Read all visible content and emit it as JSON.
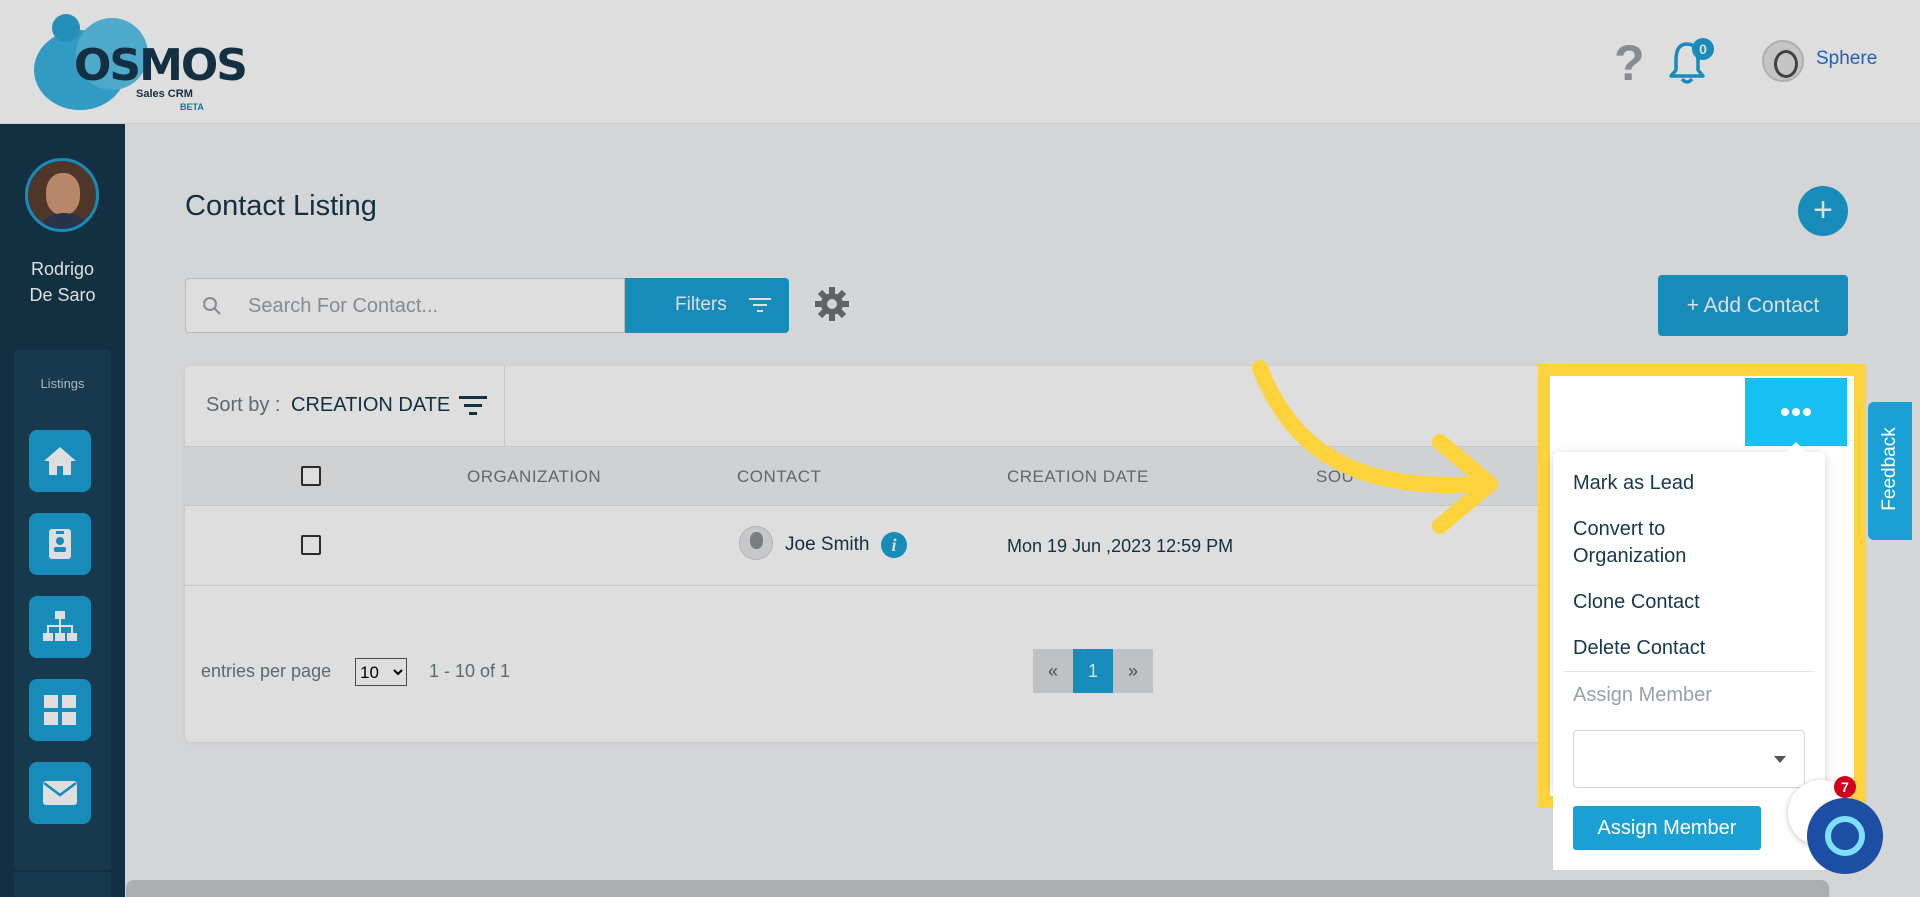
{
  "header": {
    "logo_text": "OSMOS",
    "logo_sub": "Sales CRM",
    "logo_beta": "BETA",
    "help_icon": "question-mark-icon",
    "notification_count": "0",
    "user_name": "Sphere"
  },
  "sidebar": {
    "user_name_line1": "Rodrigo",
    "user_name_line2": "De Saro",
    "section_label": "Listings",
    "items": [
      {
        "icon": "home-icon"
      },
      {
        "icon": "contact-card-icon"
      },
      {
        "icon": "org-chart-icon"
      },
      {
        "icon": "grid-icon"
      },
      {
        "icon": "mail-icon"
      }
    ]
  },
  "page": {
    "title": "Contact Listing",
    "search_placeholder": "Search For Contact...",
    "filters_label": "Filters",
    "add_contact_label": "+ Add Contact",
    "sort_label": "Sort by :",
    "sort_value": "CREATION DATE"
  },
  "table": {
    "columns": [
      "ORGANIZATION",
      "CONTACT",
      "CREATION DATE",
      "SOU"
    ],
    "rows": [
      {
        "organization": "",
        "contact": "Joe Smith",
        "creation_date": "Mon 19 Jun ,2023 12:59 PM"
      }
    ]
  },
  "pagination": {
    "entries_label": "entries per page",
    "per_page": "10",
    "range": "1 - 10 of 1",
    "prev": "«",
    "current": "1",
    "next": "»"
  },
  "actions_menu": {
    "items": [
      "Mark as Lead",
      "Convert to Organization",
      "Clone Contact",
      "Delete Contact"
    ],
    "assign_label": "Assign Member",
    "assign_button": "Assign Member"
  },
  "feedback_label": "Feedback",
  "chat_badge": "7",
  "colors": {
    "brand": "#1ba0d6",
    "sidebar": "#16384c",
    "highlight": "#fdd33d",
    "menu_button": "#16c0f2"
  }
}
